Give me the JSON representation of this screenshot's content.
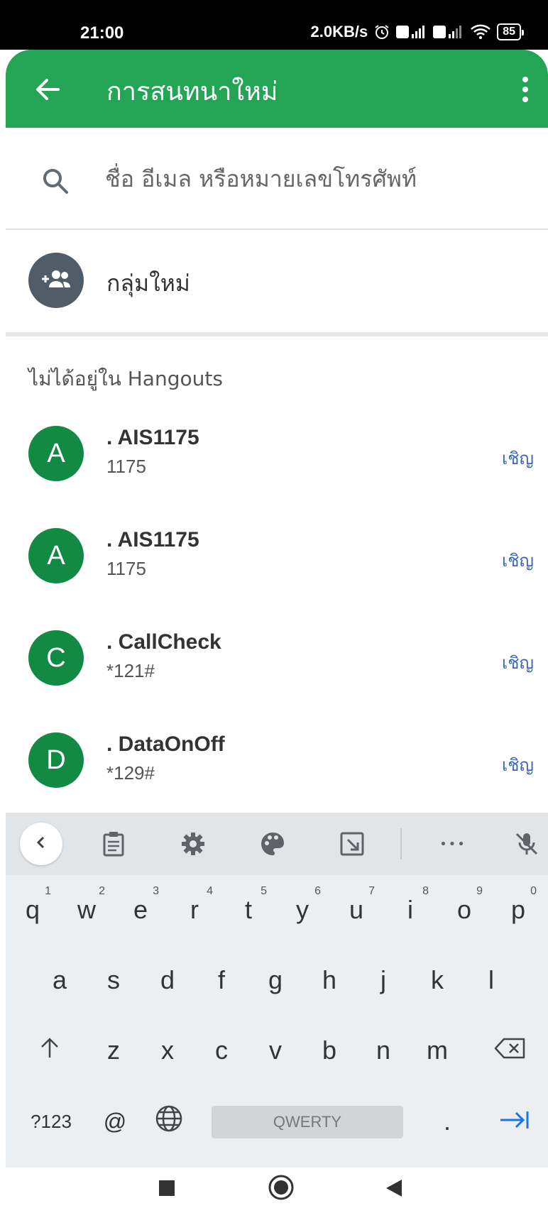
{
  "status": {
    "time": "21:00",
    "speed": "2.0KB/s",
    "battery": "85"
  },
  "app_bar": {
    "title": "การสนทนาใหม่"
  },
  "search": {
    "placeholder": "ชื่อ อีเมล หรือหมายเลขโทรศัพท์"
  },
  "new_group": {
    "label": "กลุ่มใหม่"
  },
  "section": {
    "header": "ไม่ได้อยู่ใน Hangouts"
  },
  "contacts": [
    {
      "initial": "A",
      "name": ". AIS1175",
      "sub": "1175",
      "action": "เชิญ"
    },
    {
      "initial": "A",
      "name": ". AIS1175",
      "sub": "1175",
      "action": "เชิญ"
    },
    {
      "initial": "C",
      "name": ". CallCheck",
      "sub": "*121#",
      "action": "เชิญ"
    },
    {
      "initial": "D",
      "name": ". DataOnOff",
      "sub": "*129#",
      "action": "เชิญ"
    }
  ],
  "keyboard": {
    "row1": [
      "q",
      "w",
      "e",
      "r",
      "t",
      "y",
      "u",
      "i",
      "o",
      "p"
    ],
    "row1_hints": [
      "1",
      "2",
      "3",
      "4",
      "5",
      "6",
      "7",
      "8",
      "9",
      "0"
    ],
    "row2": [
      "a",
      "s",
      "d",
      "f",
      "g",
      "h",
      "j",
      "k",
      "l"
    ],
    "row3": [
      "z",
      "x",
      "c",
      "v",
      "b",
      "n",
      "m"
    ],
    "symbols_label": "?123",
    "at_label": "@",
    "space_label": "QWERTY",
    "period_label": ".",
    "toolbar_more": "•••"
  },
  "colors": {
    "app_bar": "#24a556",
    "avatar": "#138a44",
    "group_avatar": "#505d68",
    "invite": "#3a66b8",
    "enter_key": "#1a73e8"
  }
}
